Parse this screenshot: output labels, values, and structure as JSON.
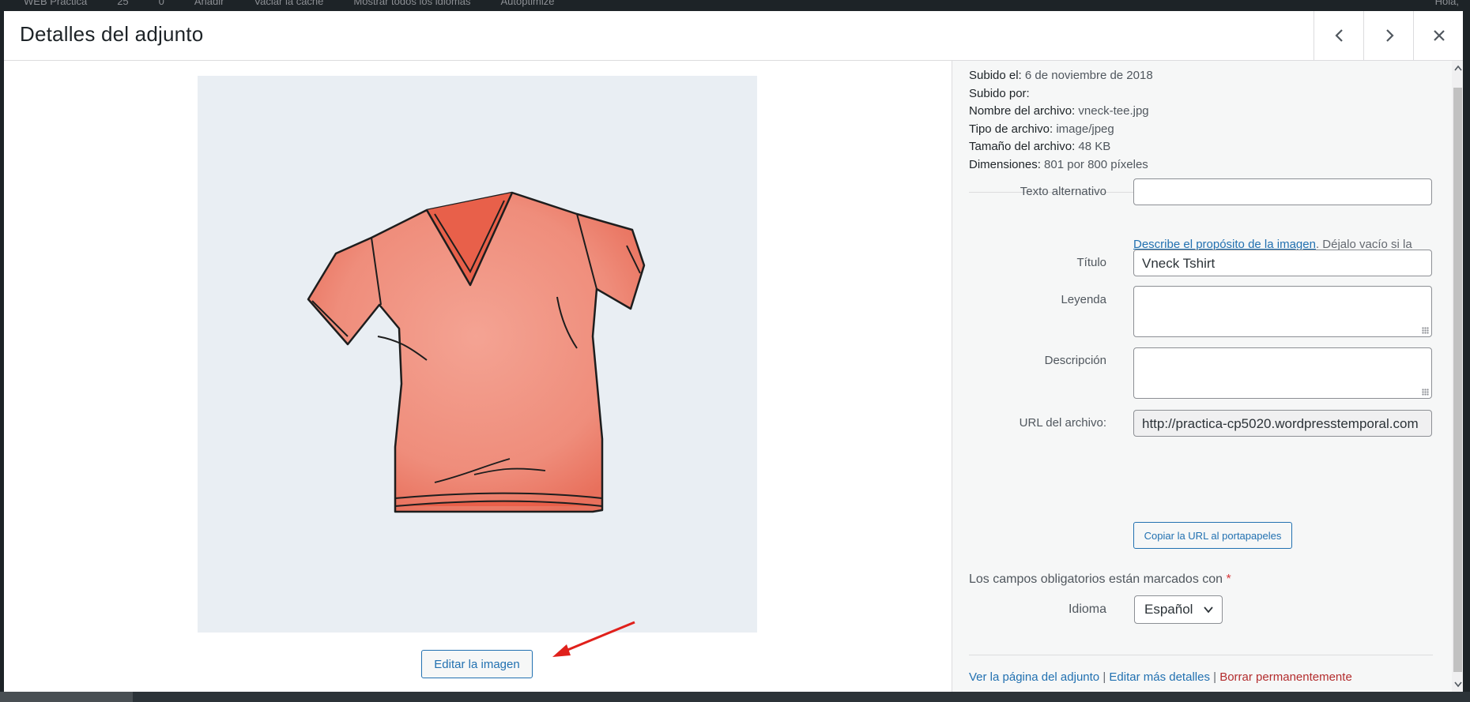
{
  "adminbar": {
    "items": [
      "WEB Práctica",
      "25",
      "0",
      "Añadir",
      "Vaciar la caché",
      "Mostrar todos los idiomas",
      "Autoptimize"
    ],
    "right": "Hola,"
  },
  "modal": {
    "title": "Detalles del adjunto",
    "prev_icon": "chevron-left-icon",
    "next_icon": "chevron-right-icon",
    "close_icon": "close-icon"
  },
  "preview": {
    "image_subject": "vneck-tshirt-illustration",
    "edit_button": "Editar la imagen",
    "annotation": "red-arrow-pointing-to-edit-button"
  },
  "file_info": {
    "uploaded_on_label": "Subido el:",
    "uploaded_on": "6 de noviembre de 2018",
    "uploaded_by_label": "Subido por:",
    "uploaded_by": "",
    "filename_label": "Nombre del archivo:",
    "filename": "vneck-tee.jpg",
    "filetype_label": "Tipo de archivo:",
    "filetype": "image/jpeg",
    "filesize_label": "Tamaño del archivo:",
    "filesize": "48 KB",
    "dimensions_label": "Dimensiones:",
    "dimensions": "801 por 800 píxeles"
  },
  "fields": {
    "alt_label": "Texto alternativo",
    "alt_value": "",
    "alt_help_link": "Describe el propósito de la imagen",
    "alt_help_rest": ". Déjalo vacío si la imagen es puramente decorativa.",
    "title_label": "Título",
    "title_value": "Vneck Tshirt",
    "caption_label": "Leyenda",
    "caption_value": "",
    "description_label": "Descripción",
    "description_value": "",
    "url_label": "URL del archivo:",
    "url_value": "http://practica-cp5020.wordpresstemporal.com",
    "copy_button": "Copiar la URL al portapapeles",
    "required_note": "Los campos obligatorios están marcados con",
    "required_star": "*",
    "language_label": "Idioma",
    "language_value": "Español"
  },
  "actions": {
    "view": "Ver la página del adjunto",
    "edit_more": "Editar más detalles",
    "delete": "Borrar permanentemente",
    "separator": "|"
  },
  "colors": {
    "accent": "#2271b1",
    "danger": "#b32d2e",
    "required": "#d63638",
    "image_bg": "#e9eef3",
    "shirt": "#f08a78",
    "annotation": "#e0201b"
  }
}
